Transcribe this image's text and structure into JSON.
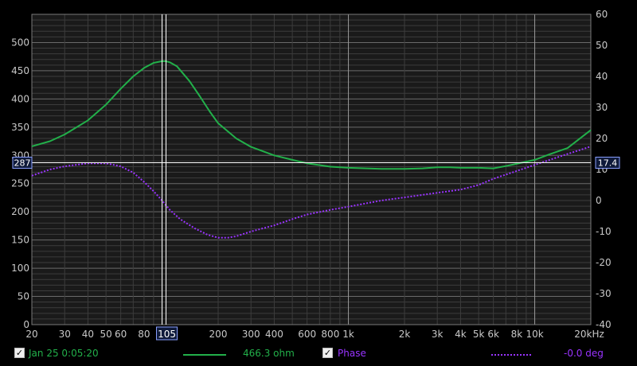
{
  "colors": {
    "background": "#000000",
    "plot_bg": "#1a1a1a",
    "grid_major": "#6a6a6a",
    "grid_minor": "#3c3c3c",
    "axis_text": "#c8c8c8",
    "impedance": "#22b04a",
    "phase": "#9933ff",
    "cursor": "#ffffff",
    "cursor_box": "#0f1a3a",
    "cursor_box_border": "#8aa0ff"
  },
  "legend": {
    "trace1_label": "Jan 25 0:05:20",
    "trace1_value": "466.3 ohm",
    "trace2_label": "Phase",
    "trace2_value": "-0.0 deg",
    "trace1_icon": "checkbox-checked-icon",
    "trace2_icon": "checkbox-checked-icon"
  },
  "cursor": {
    "freq_label": "105",
    "left_label": "287",
    "right_label": "17.4",
    "freq": 105,
    "ohm": 287
  },
  "chart_data": {
    "type": "line",
    "xscale": "log",
    "xlim": [
      20,
      20000
    ],
    "ylabel": "ohm",
    "y2label": "deg",
    "ylim": [
      0,
      550
    ],
    "y2lim": [
      -40,
      60
    ],
    "grid": true,
    "xticks": [
      {
        "v": 20,
        "t": "20"
      },
      {
        "v": 30,
        "t": "30"
      },
      {
        "v": 40,
        "t": "40"
      },
      {
        "v": 50,
        "t": "50"
      },
      {
        "v": 60,
        "t": "60"
      },
      {
        "v": 80,
        "t": "80"
      },
      {
        "v": 200,
        "t": "200"
      },
      {
        "v": 300,
        "t": "300"
      },
      {
        "v": 400,
        "t": "400"
      },
      {
        "v": 600,
        "t": "600"
      },
      {
        "v": 800,
        "t": "800"
      },
      {
        "v": 1000,
        "t": "1k"
      },
      {
        "v": 2000,
        "t": "2k"
      },
      {
        "v": 3000,
        "t": "3k"
      },
      {
        "v": 4000,
        "t": "4k"
      },
      {
        "v": 5000,
        "t": "5k"
      },
      {
        "v": 6000,
        "t": "6k"
      },
      {
        "v": 8000,
        "t": "8k"
      },
      {
        "v": 10000,
        "t": "10k"
      },
      {
        "v": 20000,
        "t": "20kHz"
      }
    ],
    "yticks": [
      0,
      50,
      100,
      150,
      200,
      250,
      300,
      350,
      400,
      450,
      500
    ],
    "y2ticks": [
      -40,
      -30,
      -20,
      -10,
      0,
      10,
      20,
      30,
      40,
      50,
      60
    ],
    "series": [
      {
        "name": "Jan 25 0:05:20",
        "axis": "left",
        "style": "solid",
        "x": [
          20,
          25,
          30,
          40,
          50,
          60,
          70,
          80,
          90,
          100,
          105,
          110,
          120,
          140,
          160,
          180,
          200,
          250,
          300,
          400,
          500,
          600,
          800,
          1000,
          1500,
          2000,
          2500,
          3000,
          3500,
          4000,
          5000,
          6000,
          7000,
          8000,
          10000,
          12000,
          15000,
          20000
        ],
        "y": [
          316,
          325,
          337,
          362,
          390,
          418,
          440,
          455,
          464,
          467,
          467,
          465,
          458,
          432,
          404,
          378,
          357,
          330,
          315,
          300,
          292,
          286,
          280,
          278,
          276,
          276,
          277,
          279,
          279,
          278,
          278,
          277,
          281,
          285,
          292,
          302,
          313,
          345
        ]
      },
      {
        "name": "Phase",
        "axis": "right",
        "style": "dotted",
        "x": [
          20,
          25,
          30,
          40,
          50,
          60,
          70,
          80,
          90,
          100,
          110,
          125,
          150,
          175,
          200,
          225,
          250,
          300,
          400,
          500,
          600,
          800,
          1000,
          1500,
          2000,
          3000,
          4000,
          5000,
          6000,
          8000,
          10000,
          15000,
          20000
        ],
        "y": [
          8,
          10,
          11,
          12,
          12,
          11,
          9,
          6,
          3,
          0,
          -3,
          -6,
          -9,
          -11,
          -12,
          -12,
          -11.5,
          -10,
          -8,
          -6,
          -4.5,
          -3,
          -2,
          0,
          1,
          2.5,
          3.5,
          5,
          7,
          9.5,
          11.5,
          15,
          17.4
        ]
      }
    ]
  }
}
